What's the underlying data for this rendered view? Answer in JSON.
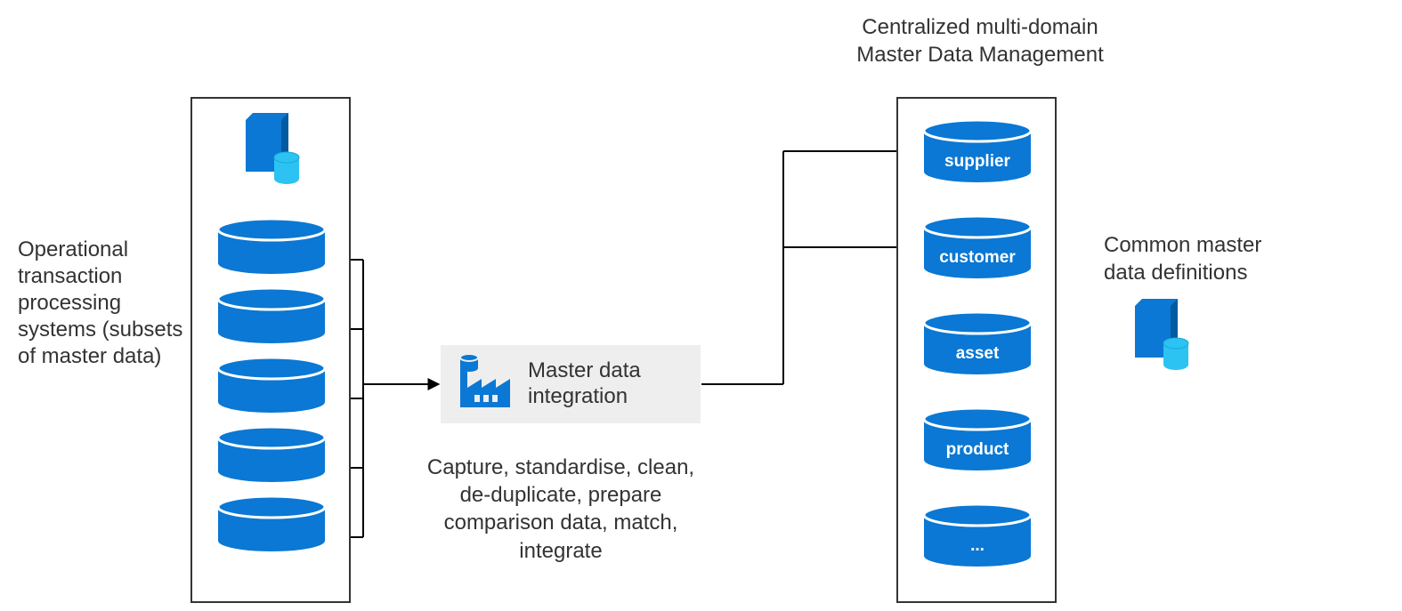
{
  "left_label": "Operational transaction processing systems (subsets of master data)",
  "right_title_line1": "Centralized multi-domain",
  "right_title_line2": "Master Data Management",
  "integration_line1": "Master data",
  "integration_line2": "integration",
  "caption": "Capture, standardise, clean, de-duplicate, prepare comparison data, match, integrate",
  "defs_label": "Common master data definitions",
  "dbs": {
    "supplier": "supplier",
    "customer": "customer",
    "asset": "asset",
    "product": "product",
    "more": "..."
  },
  "colors": {
    "azure_blue": "#0a78d4",
    "azure_blue_dark": "#005ba1",
    "azure_cyan": "#2cc3f2"
  }
}
